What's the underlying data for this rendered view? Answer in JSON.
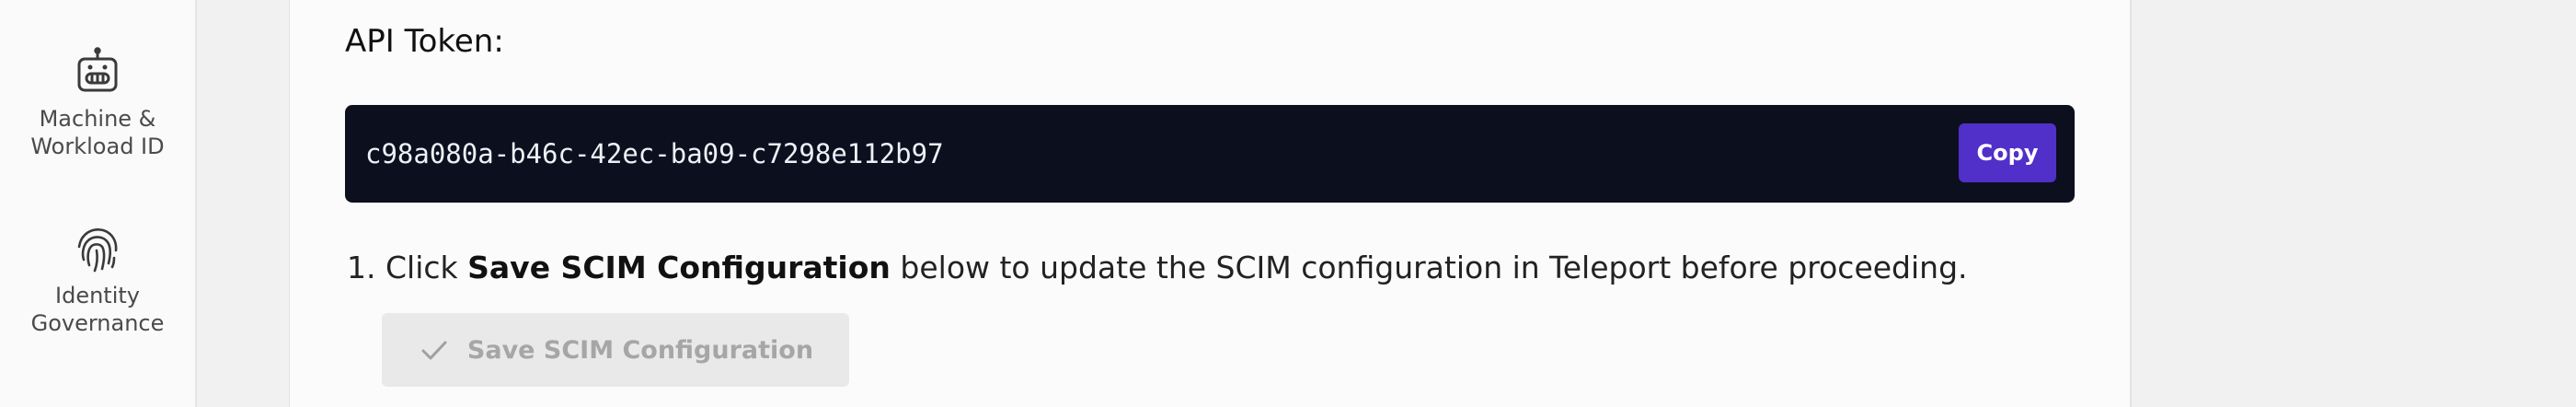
{
  "sidebar": {
    "items": [
      {
        "label": "Machine &\nWorkload ID",
        "icon": "robot-icon"
      },
      {
        "label": "Identity\nGovernance",
        "icon": "fingerprint-icon"
      }
    ]
  },
  "token": {
    "title": "API Token:",
    "value": "c98a080a-b46c-42ec-ba09-c7298e112b97",
    "copy_label": "Copy"
  },
  "steps": [
    {
      "number": "1.",
      "prefix": "Click",
      "emphasis": "Save SCIM Configuration",
      "suffix": "below to update the SCIM configuration in Teleport before proceeding."
    }
  ],
  "save_button": {
    "label": "Save SCIM Configuration",
    "icon": "check-icon",
    "disabled": true
  },
  "colors": {
    "accent": "#512fc9",
    "token_bg": "#0c0f1e"
  }
}
